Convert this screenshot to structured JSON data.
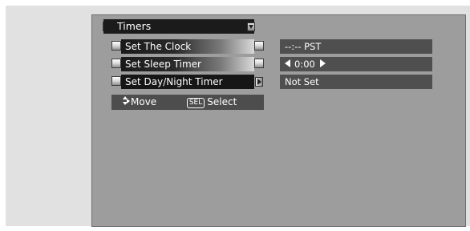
{
  "menu": {
    "title": "Timers",
    "items": [
      {
        "label": "Set The Clock",
        "value": "--:-- PST"
      },
      {
        "label": "Set Sleep Timer",
        "value": "0:00"
      },
      {
        "label": "Set Day/Night Timer",
        "value": "Not Set",
        "active": true
      }
    ]
  },
  "help": {
    "move_label": "Move",
    "sel_badge": "SEL",
    "select_label": "Select"
  },
  "colors": {
    "panel_bg": "#9d9d9d",
    "bar_dark": "#1b1b1b",
    "value_bg": "#4f4f4f"
  }
}
